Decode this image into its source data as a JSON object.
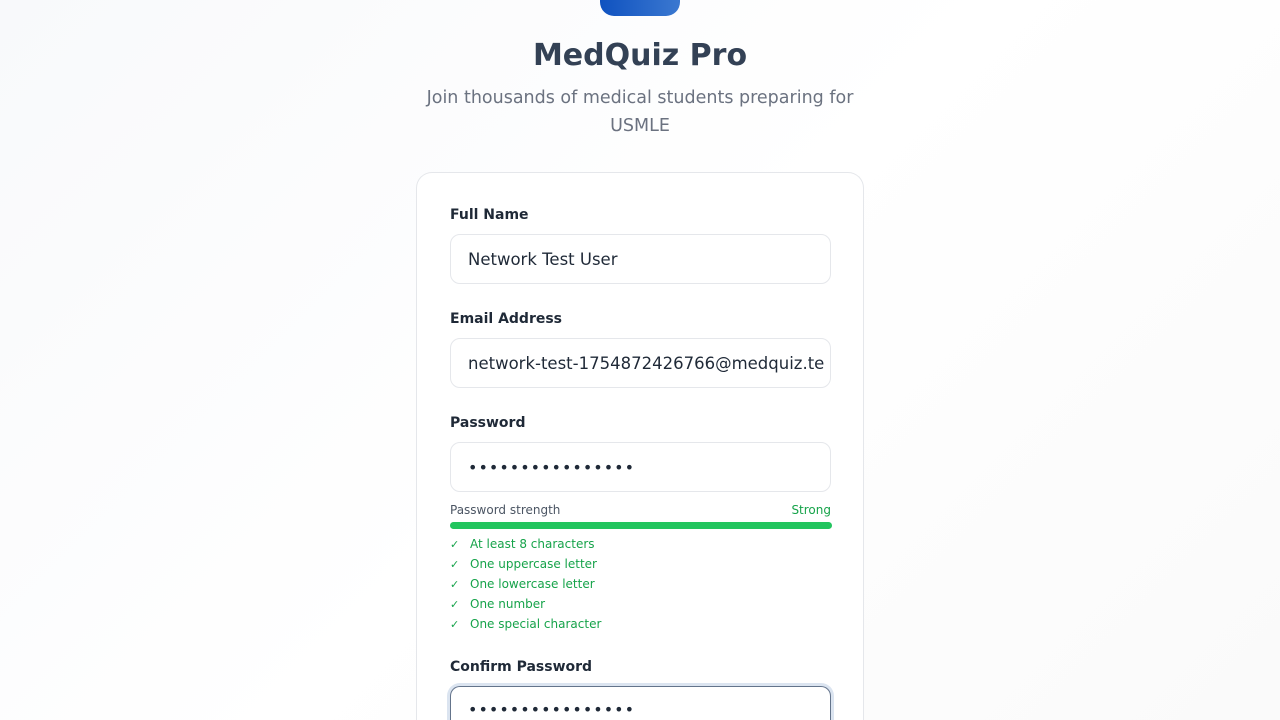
{
  "header": {
    "title": "MedQuiz Pro",
    "subtitle": "Join thousands of medical students preparing for USMLE"
  },
  "form": {
    "full_name": {
      "label": "Full Name",
      "value": "Network Test User"
    },
    "email": {
      "label": "Email Address",
      "value": "network-test-1754872426766@medquiz.te"
    },
    "password": {
      "label": "Password",
      "value": "••••••••••••••••"
    },
    "strength": {
      "label": "Password strength",
      "value": "Strong",
      "percent": 100
    },
    "requirements": [
      "At least 8 characters",
      "One uppercase letter",
      "One lowercase letter",
      "One number",
      "One special character"
    ],
    "confirm": {
      "label": "Confirm Password",
      "value": "••••••••••••••••"
    }
  },
  "colors": {
    "accent": "#22c55e",
    "brand": "#0f52c0"
  }
}
